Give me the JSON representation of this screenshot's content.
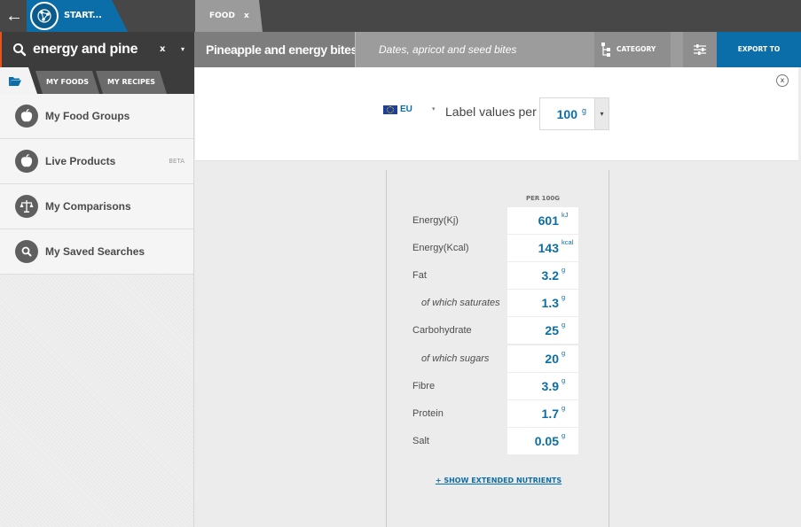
{
  "topbar": {
    "start_label": "START...",
    "food_tab_label": "FOOD",
    "food_tab_close": "x"
  },
  "search": {
    "value": "energy and pine",
    "clear": "x",
    "dropdown": "▾"
  },
  "food": {
    "title_primary": "Pineapple and energy bites",
    "title_secondary": "Dates, apricot and seed bites",
    "category_label": "CATEGORY",
    "export_label": "EXPORT TO"
  },
  "sidebar": {
    "tabs": [
      "MY FOODS",
      "MY RECIPES"
    ],
    "items": [
      {
        "label": "My Food Groups",
        "icon": "apple-icon",
        "badge": ""
      },
      {
        "label": "Live Products",
        "icon": "apple-icon",
        "badge": "BETA"
      },
      {
        "label": "My Comparisons",
        "icon": "scales-icon",
        "badge": ""
      },
      {
        "label": "My Saved Searches",
        "icon": "search-icon",
        "badge": ""
      }
    ]
  },
  "label_settings": {
    "close": "x",
    "region": "EU",
    "region_arrow": "▾",
    "per_label": "Label values per",
    "per_value": "100",
    "per_unit": "g",
    "per_dropdown": "▾"
  },
  "nutrition": {
    "column_header": "PER 100G",
    "rows": [
      {
        "name": "Energy(Kj)",
        "value": "601",
        "unit": "kJ",
        "sub": false
      },
      {
        "name": "Energy(Kcal)",
        "value": "143",
        "unit": "kcal",
        "sub": false
      },
      {
        "name": "Fat",
        "value": "3.2",
        "unit": "g",
        "sub": false
      },
      {
        "name": "of which saturates",
        "value": "1.3",
        "unit": "g",
        "sub": true
      },
      {
        "name": "Carbohydrate",
        "value": "25",
        "unit": "g",
        "sub": false
      },
      {
        "name": "of which sugars",
        "value": "20",
        "unit": "g",
        "sub": true
      },
      {
        "name": "Fibre",
        "value": "3.9",
        "unit": "g",
        "sub": false
      },
      {
        "name": "Protein",
        "value": "1.7",
        "unit": "g",
        "sub": false
      },
      {
        "name": "Salt",
        "value": "0.05",
        "unit": "g",
        "sub": false
      }
    ],
    "show_more": "+ SHOW EXTENDED NUTRIENTS"
  },
  "colors": {
    "accent": "#0b6ea8",
    "search_accent": "#e6541b",
    "dark_bar": "#474747"
  }
}
